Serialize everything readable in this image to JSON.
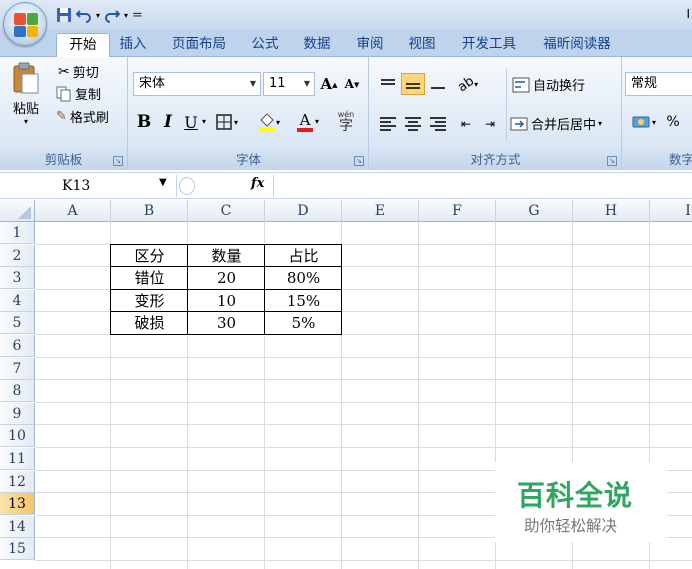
{
  "quick_access": {
    "undo_icon": "undo-icon",
    "redo_icon": "redo-icon",
    "save_icon": "save-icon",
    "customize": "="
  },
  "title_edge": "I",
  "tabs": [
    "开始",
    "插入",
    "页面布局",
    "公式",
    "数据",
    "审阅",
    "视图",
    "开发工具",
    "福昕阅读器"
  ],
  "active_tab": "开始",
  "clipboard": {
    "paste": "粘贴",
    "cut": "剪切",
    "copy": "复制",
    "format_painter": "格式刷",
    "label": "剪贴板"
  },
  "font": {
    "name": "宋体",
    "size": "11",
    "bold": "B",
    "italic": "I",
    "underline": "U",
    "label": "字体",
    "grow": "A",
    "shrink": "A",
    "phonetic": "wén",
    "font_color_letter": "A"
  },
  "alignment": {
    "wrap_text": "自动换行",
    "merge_center": "合并后居中",
    "label": "对齐方式"
  },
  "number": {
    "format": "常规",
    "percent": "%",
    "label": "数字"
  },
  "formula_bar": {
    "name_box": "K13",
    "fx": "fx",
    "formula": ""
  },
  "columns": [
    "A",
    "B",
    "C",
    "D",
    "E",
    "F",
    "G",
    "H",
    "I"
  ],
  "rows": [
    "1",
    "2",
    "3",
    "4",
    "5",
    "6",
    "7",
    "8",
    "9",
    "10",
    "11",
    "12",
    "13",
    "14",
    "15"
  ],
  "selected_row": "13",
  "table": {
    "headers": [
      "区分",
      "数量",
      "占比"
    ],
    "rows": [
      [
        "错位",
        "20",
        "80%"
      ],
      [
        "变形",
        "10",
        "15%"
      ],
      [
        "破损",
        "30",
        "5%"
      ]
    ]
  },
  "watermark": {
    "title": "百科全说",
    "subtitle": "助你轻松解决"
  },
  "colors": {
    "ribbon_text": "#15428b",
    "watermark_green": "#2fa561",
    "row_highlight": "#f5c46b"
  }
}
